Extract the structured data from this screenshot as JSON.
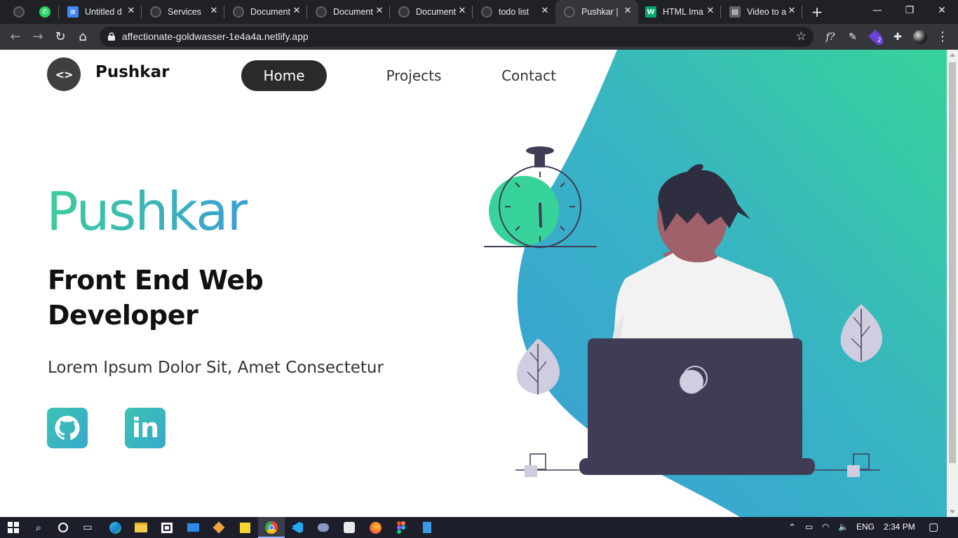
{
  "browser": {
    "tabs": [
      {
        "title": "",
        "favicon": "globe-icon"
      },
      {
        "title": "",
        "favicon": "whatsapp-icon"
      },
      {
        "title": "Untitled d",
        "favicon": "docs-icon"
      },
      {
        "title": "Services",
        "favicon": "globe-icon"
      },
      {
        "title": "Document",
        "favicon": "globe-icon"
      },
      {
        "title": "Document",
        "favicon": "globe-icon"
      },
      {
        "title": "Document",
        "favicon": "globe-icon"
      },
      {
        "title": "todo list",
        "favicon": "globe-icon"
      },
      {
        "title": "Pushkar |",
        "favicon": "globe-icon",
        "active": true
      },
      {
        "title": "HTML Ima",
        "favicon": "w3schools-icon"
      },
      {
        "title": "Video to a",
        "favicon": "converter-icon"
      }
    ],
    "url": "affectionate-goldwasser-1e4a4a.netlify.app",
    "extension_badge": "2"
  },
  "site": {
    "logo_text": "<>",
    "brand": "Pushkar",
    "nav": {
      "home": "Home",
      "projects": "Projects",
      "contact": "Contact"
    },
    "hero": {
      "name": "Pushkar",
      "role": "Front End Web Developer",
      "tagline": "Lorem Ipsum Dolor Sit, Amet Consectetur"
    },
    "social": {
      "github": "github-icon",
      "linkedin_text": "in"
    },
    "colors": {
      "accent_green": "#3ccd99",
      "accent_blue": "#3a9fd4",
      "dark": "#3f3d56"
    }
  },
  "taskbar": {
    "language": "ENG",
    "time": "2:34 PM"
  }
}
